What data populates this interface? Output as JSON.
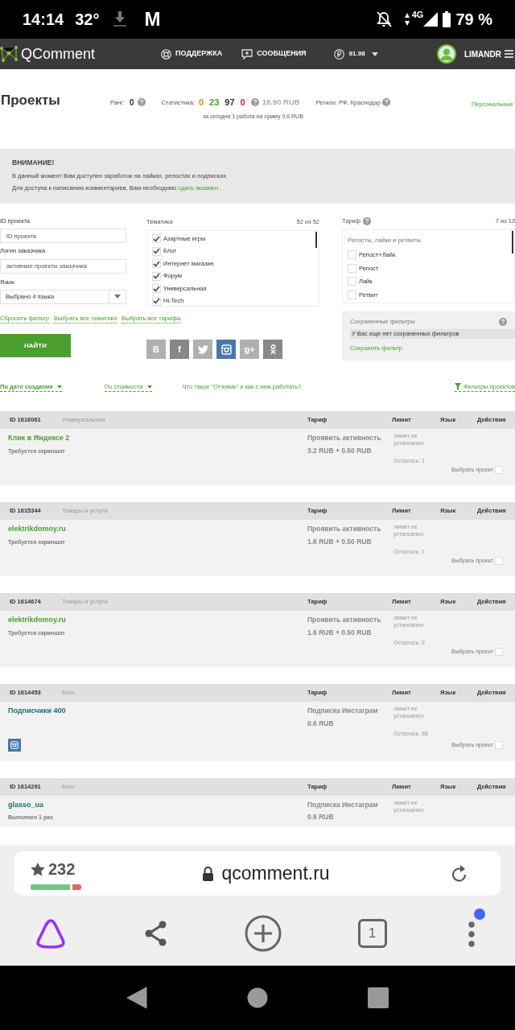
{
  "status_bar": {
    "time": "14:14",
    "temperature": "32°",
    "mail_glyph": "M",
    "network": "4G",
    "battery": "79 %"
  },
  "header": {
    "logo": "QComment",
    "nav": [
      {
        "kind": "support",
        "label": "ПОДДЕРЖКА"
      },
      {
        "kind": "messages",
        "label": "СООБЩЕНИЯ"
      }
    ],
    "balance": "91.98",
    "user": "LIMANDR"
  },
  "summary": {
    "title": "Проекты",
    "rank_label": "Ранг:",
    "rank": "0",
    "stats_label": "Статистика:",
    "stats": [
      {
        "value": "0",
        "color": "#f08a24"
      },
      {
        "value": "23",
        "color": "#4a9d2f"
      },
      {
        "value": "97",
        "color": "#333333"
      },
      {
        "value": "0",
        "color": "#d9261c"
      }
    ],
    "amount": "16.90 RUB",
    "today": "за сегодня 1 работа на сумму 0.6 RUB",
    "region": "Регион: РФ, Краснодар",
    "personal_link": "Персональные"
  },
  "notice": {
    "title": "ВНИМАНИЕ!",
    "line_1": "В данный момент Вам доступен заработок на лайках, репостах и подписках.",
    "line_2": "Для доступа к написанию комментариев, Вам необходимо",
    "link": "сдать экзамен",
    "line_2_end": "."
  },
  "filters": {
    "fields": [
      {
        "label": "ID проекта",
        "placeholder": "ID проекта"
      },
      {
        "label": "Логин заказчика",
        "placeholder": "активные проекты заказчика"
      }
    ],
    "language": {
      "label": "Язык",
      "value": "Выбрано 4 языка"
    },
    "themes": {
      "label": "Тематика",
      "count": "52 из 52",
      "items": [
        {
          "label": "Азартные игры",
          "checked": true
        },
        {
          "label": "Блог",
          "checked": true
        },
        {
          "label": "Интернет магазин",
          "checked": true
        },
        {
          "label": "Форум",
          "checked": true
        },
        {
          "label": "Универсальная",
          "checked": true
        },
        {
          "label": "Hi-Tech",
          "checked": true
        }
      ]
    },
    "tariffs": {
      "label": "Тариф",
      "count": "7 из 13",
      "group": "Репосты, лайки и ретвиты",
      "items": [
        {
          "label": "Репост+Лайк",
          "checked": false
        },
        {
          "label": "Репост",
          "checked": false
        },
        {
          "label": "Лайк",
          "checked": false
        },
        {
          "label": "Ретвит",
          "checked": false
        }
      ]
    },
    "links": [
      "Сбросить фильтр",
      "Выбрать все тематики",
      "Выбрать все тарифы"
    ],
    "find_button": "НАЙТИ",
    "networks": [
      {
        "kind": "text",
        "label": "B",
        "selected": false
      },
      {
        "kind": "text",
        "label": "f",
        "selected": false
      },
      {
        "kind": "twitter",
        "selected": false
      },
      {
        "kind": "instagram",
        "selected": true
      },
      {
        "kind": "text",
        "label": "g+",
        "selected": false
      },
      {
        "kind": "ok",
        "selected": false
      }
    ],
    "saved": {
      "title": "Сохраненные фильтры",
      "empty": "У Вас еще нет сохраненных фильтров",
      "save_link": "Сохранить фильтр"
    }
  },
  "sorting": {
    "options": [
      "По дате создания",
      "По стоимости"
    ],
    "help_link": "Что такое \"Отзовик\" и как с ним работать?",
    "filters_link": "Фильтры проектов"
  },
  "projects": [
    {
      "id": "ID 1616061",
      "category": "Универсальная",
      "columns": [
        "Тариф",
        "Лимит",
        "Язык",
        "Действия"
      ],
      "title": "Клик в Яндексе 2",
      "color": "#4a9d2f",
      "note": "Требуется скриншот",
      "tariff": "Проявить активность",
      "price": "3.2 RUB + 0.50 RUB",
      "limit": "лимит не установлен",
      "remaining": "Осталось: 1",
      "select_label": "Выбрать проект",
      "selected": false
    },
    {
      "id": "ID 1615344",
      "category": "Товары и услуги",
      "columns": [
        "Тариф",
        "Лимит",
        "Язык",
        "Действия"
      ],
      "title": "elektrikdomoy.ru",
      "color": "#4a9d2f",
      "note": "Требуется скриншот",
      "tariff": "Проявить активность",
      "price": "1.6 RUB + 0.50 RUB",
      "limit": "лимит не установлен",
      "remaining": "Осталось: 1",
      "select_label": "Выбрать проект",
      "selected": false
    },
    {
      "id": "ID 1614674",
      "category": "Товары и услуги",
      "columns": [
        "Тариф",
        "Лимит",
        "Язык",
        "Действия"
      ],
      "title": "elektrikdomoy.ru",
      "color": "#4a9d2f",
      "note": "Требуется скриншот",
      "tariff": "Проявить активность",
      "price": "1.6 RUB + 0.50 RUB",
      "limit": "лимит не установлен",
      "remaining": "Осталось: 2",
      "select_label": "Выбрать проект",
      "selected": false
    },
    {
      "id": "ID 1614453",
      "category": "Блог",
      "columns": [
        "Тариф",
        "Лимит",
        "Язык",
        "Действия"
      ],
      "title": "Подписчики 400",
      "color": "#1f6e6e",
      "instagram_badge": true,
      "tariff": "Подписка Инстаграм",
      "price": "0.6 RUB",
      "limit": "лимит не установлен",
      "remaining": "Осталось: 88",
      "select_label": "Выбрать проект",
      "selected": false
    },
    {
      "id": "ID 1614291",
      "category": "Блог",
      "columns": [
        "Тариф",
        "Лимит",
        "Язык",
        "Действия"
      ],
      "title": "glasso_ua",
      "color": "#1f6e6e",
      "note": "Выполнен 1 раз",
      "tariff": "Подписка Инстаграм",
      "price": "0.6 RUB",
      "limit": "лимит не установлен"
    }
  ],
  "browser": {
    "rating": "232",
    "rating_bar": {
      "level": 0.82
    },
    "url": "qcomment.ru",
    "tab_count": "1",
    "menu_notification": true
  }
}
